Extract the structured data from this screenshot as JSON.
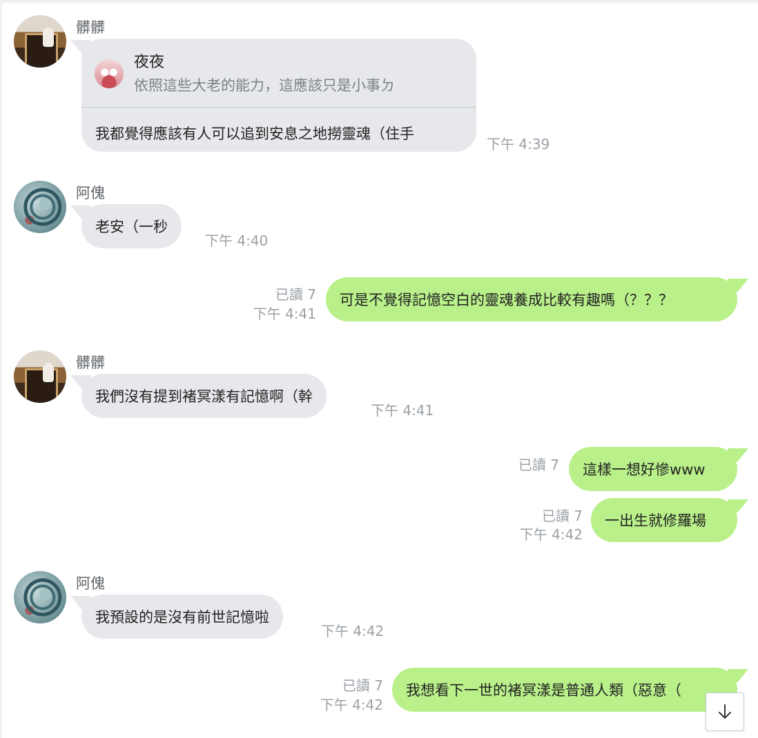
{
  "messages": [
    {
      "sender": "髒髒",
      "quote_sender": "夜夜",
      "quote_text": "依照這些大老的能力，這應該只是小事ㄉ",
      "text": "我都覺得應該有人可以追到安息之地撈靈魂（住手",
      "time": "下午 4:39"
    },
    {
      "sender": "阿傀",
      "text": "老安（一秒",
      "time": "下午 4:40"
    },
    {
      "read": "已讀 7",
      "time": "下午 4:41",
      "text": "可是不覺得記憶空白的靈魂養成比較有趣嗎（？？？"
    },
    {
      "sender": "髒髒",
      "text": "我們沒有提到褚冥漾有記憶啊（幹",
      "time": "下午 4:41"
    },
    {
      "read": "已讀 7",
      "text": "這樣一想好慘www"
    },
    {
      "read": "已讀 7",
      "time": "下午 4:42",
      "text": "一出生就修羅場"
    },
    {
      "sender": "阿傀",
      "text": "我預設的是沒有前世記憶啦",
      "time": "下午 4:42"
    },
    {
      "read": "已讀 7",
      "time": "下午 4:42",
      "text": "我想看下一世的褚冥漾是普通人類（惡意（"
    }
  ],
  "scroll_button": {
    "icon": "arrow-down-icon"
  },
  "colors": {
    "incoming_bubble": "#e6e8eb",
    "outgoing_bubble": "#b9f08a",
    "meta_text": "#9aa0a6",
    "name_text": "#5f6368"
  }
}
